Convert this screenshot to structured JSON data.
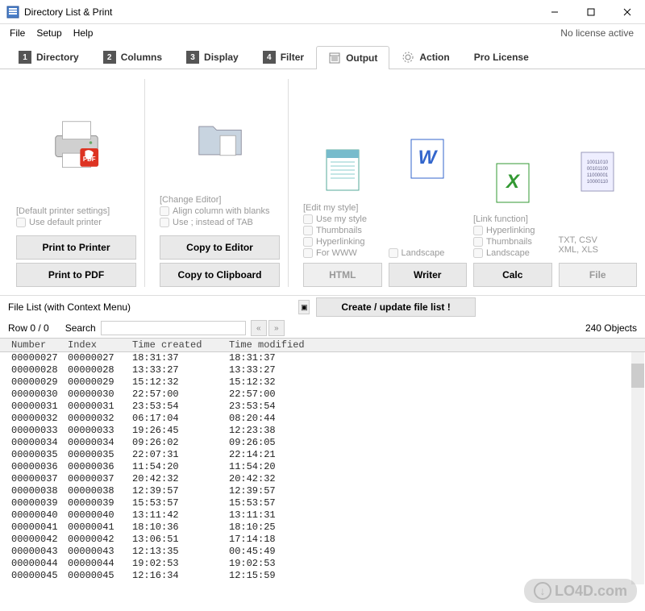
{
  "window": {
    "title": "Directory List & Print",
    "license_status": "No license active"
  },
  "menus": [
    "File",
    "Setup",
    "Help"
  ],
  "tabs": [
    {
      "num": "1",
      "label": "Directory"
    },
    {
      "num": "2",
      "label": "Columns"
    },
    {
      "num": "3",
      "label": "Display"
    },
    {
      "num": "4",
      "label": "Filter"
    },
    {
      "icon": "output",
      "label": "Output",
      "active": true
    },
    {
      "icon": "gear",
      "label": "Action"
    },
    {
      "label": "Pro License"
    }
  ],
  "panel_printer": {
    "settings_label": "[Default printer settings]",
    "use_default": "Use default printer",
    "btn_print": "Print to Printer",
    "btn_pdf": "Print to PDF"
  },
  "panel_editor": {
    "change_label": "[Change Editor]",
    "align_blanks": "Align column with blanks",
    "use_semicolon": "Use ; instead of TAB",
    "btn_copy_editor": "Copy to Editor",
    "btn_copy_clipboard": "Copy to Clipboard"
  },
  "panel_output": {
    "edit_style_label": "[Edit my style]",
    "use_my_style": "Use my style",
    "thumbnails": "Thumbnails",
    "hyperlinking": "Hyperlinking",
    "for_www": "For WWW",
    "landscape": "Landscape",
    "link_function_label": "[Link function]",
    "txt_csv": "TXT, CSV",
    "xml_xls": "XML, XLS",
    "btn_html": "HTML",
    "btn_writer": "Writer",
    "btn_calc": "Calc",
    "btn_file": "File"
  },
  "filelist": {
    "header": "File List (with Context Menu)",
    "create_btn": "Create / update file list !",
    "row_counter": "Row 0 / 0",
    "search_label": "Search",
    "search_value": "",
    "object_count": "240 Objects",
    "columns": [
      "Number",
      "Index",
      "Time created",
      "Time modified"
    ],
    "rows": [
      {
        "num": "00000027",
        "idx": "00000027",
        "tc": "18:31:37",
        "tm": "18:31:37"
      },
      {
        "num": "00000028",
        "idx": "00000028",
        "tc": "13:33:27",
        "tm": "13:33:27"
      },
      {
        "num": "00000029",
        "idx": "00000029",
        "tc": "15:12:32",
        "tm": "15:12:32"
      },
      {
        "num": "00000030",
        "idx": "00000030",
        "tc": "22:57:00",
        "tm": "22:57:00"
      },
      {
        "num": "00000031",
        "idx": "00000031",
        "tc": "23:53:54",
        "tm": "23:53:54"
      },
      {
        "num": "00000032",
        "idx": "00000032",
        "tc": "06:17:04",
        "tm": "08:20:44"
      },
      {
        "num": "00000033",
        "idx": "00000033",
        "tc": "19:26:45",
        "tm": "12:23:38"
      },
      {
        "num": "00000034",
        "idx": "00000034",
        "tc": "09:26:02",
        "tm": "09:26:05"
      },
      {
        "num": "00000035",
        "idx": "00000035",
        "tc": "22:07:31",
        "tm": "22:14:21"
      },
      {
        "num": "00000036",
        "idx": "00000036",
        "tc": "11:54:20",
        "tm": "11:54:20"
      },
      {
        "num": "00000037",
        "idx": "00000037",
        "tc": "20:42:32",
        "tm": "20:42:32"
      },
      {
        "num": "00000038",
        "idx": "00000038",
        "tc": "12:39:57",
        "tm": "12:39:57"
      },
      {
        "num": "00000039",
        "idx": "00000039",
        "tc": "15:53:57",
        "tm": "15:53:57"
      },
      {
        "num": "00000040",
        "idx": "00000040",
        "tc": "13:11:42",
        "tm": "13:11:31"
      },
      {
        "num": "00000041",
        "idx": "00000041",
        "tc": "18:10:36",
        "tm": "18:10:25"
      },
      {
        "num": "00000042",
        "idx": "00000042",
        "tc": "13:06:51",
        "tm": "17:14:18"
      },
      {
        "num": "00000043",
        "idx": "00000043",
        "tc": "12:13:35",
        "tm": "00:45:49"
      },
      {
        "num": "00000044",
        "idx": "00000044",
        "tc": "19:02:53",
        "tm": "19:02:53"
      },
      {
        "num": "00000045",
        "idx": "00000045",
        "tc": "12:16:34",
        "tm": "12:15:59"
      }
    ]
  },
  "watermark": "LO4D.com"
}
